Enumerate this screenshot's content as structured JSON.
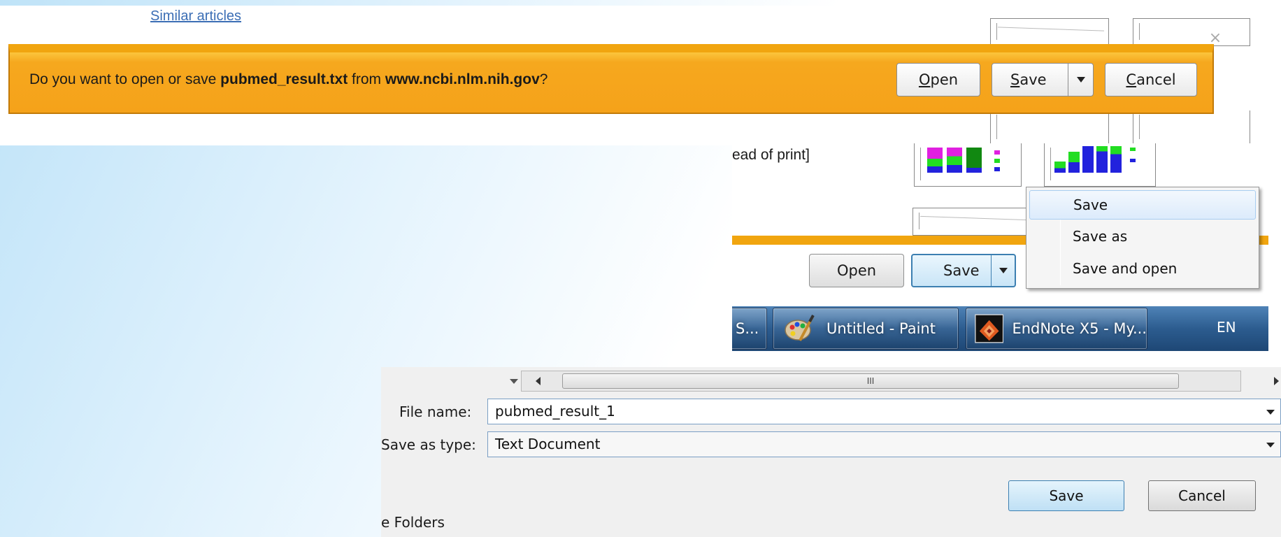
{
  "browser": {
    "similar_articles_link": "Similar articles"
  },
  "notification_bar": {
    "message_prefix": "Do you want to open or save ",
    "file_name": "pubmed_result.txt",
    "message_middle": " from ",
    "domain": "www.ncbi.nlm.nih.gov",
    "message_suffix": "?",
    "open_label": {
      "u": "O",
      "rest": "pen"
    },
    "save_label": {
      "u": "S",
      "rest": "ave"
    },
    "cancel_label": {
      "u": "C",
      "rest": "ancel"
    },
    "close_glyph": "×",
    "bar_color": "#f5a21a"
  },
  "save_menu": {
    "page_snippet": "ead of print]",
    "open_button": "Open",
    "save_button": "Save",
    "items": [
      {
        "label": "Save"
      },
      {
        "label": "Save as"
      },
      {
        "label": "Save and open"
      }
    ]
  },
  "taskbar": {
    "truncated_item": "S...",
    "paint_item": "Untitled - Paint",
    "endnote_item": "EndNote X5 - My...",
    "language": "EN"
  },
  "save_dialog": {
    "scroll_thumb_text": "III",
    "file_name_label": "File name:",
    "file_name_value": "pubmed_result_1",
    "save_type_label": "Save as type:",
    "save_type_value": "Text Document",
    "folders_toggle": "e Folders",
    "save_button": "Save",
    "cancel_button": "Cancel"
  }
}
